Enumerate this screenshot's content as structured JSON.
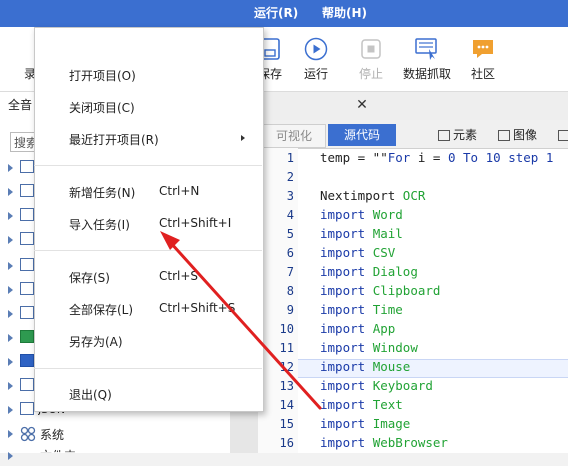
{
  "menubar": {
    "run": "运行(R)",
    "help": "帮助(H)"
  },
  "toolbar": {
    "left_cut": "录",
    "save": "保存",
    "run": "运行",
    "stop": "停止",
    "data_capture": "数据抓取",
    "community": "社区"
  },
  "left_panel": {
    "tab_label": "全音",
    "search_placeholder": "搜索",
    "tree_partial_json": "JSON",
    "tree_system": "系统",
    "tree_partial_bottom": "文件夹"
  },
  "editor": {
    "tab_visual": "可视化",
    "tab_source": "源代码",
    "btn_element": "元素",
    "btn_image": "图像",
    "lines": [
      {
        "n": "1",
        "parts": [
          [
            "",
            "temp = \"\""
          ],
          [
            "kw",
            "For"
          ],
          [
            "",
            " i = "
          ],
          [
            "kw",
            "0"
          ],
          [
            "",
            " "
          ],
          [
            "kw",
            "To"
          ],
          [
            "",
            " "
          ],
          [
            "kw",
            "10"
          ],
          [
            "",
            " "
          ],
          [
            "kw",
            "step"
          ],
          [
            "",
            " "
          ],
          [
            "kw",
            "1"
          ]
        ]
      },
      {
        "n": "2",
        "parts": []
      },
      {
        "n": "3",
        "parts": [
          [
            "",
            "Nextimport "
          ],
          [
            "mod",
            "OCR"
          ]
        ]
      },
      {
        "n": "4",
        "parts": [
          [
            "kw",
            "import"
          ],
          [
            "",
            " "
          ],
          [
            "mod",
            "Word"
          ]
        ]
      },
      {
        "n": "5",
        "parts": [
          [
            "kw",
            "import"
          ],
          [
            "",
            " "
          ],
          [
            "mod",
            "Mail"
          ]
        ]
      },
      {
        "n": "6",
        "parts": [
          [
            "kw",
            "import"
          ],
          [
            "",
            " "
          ],
          [
            "mod",
            "CSV"
          ]
        ]
      },
      {
        "n": "7",
        "parts": [
          [
            "kw",
            "import"
          ],
          [
            "",
            " "
          ],
          [
            "mod",
            "Dialog"
          ]
        ]
      },
      {
        "n": "8",
        "parts": [
          [
            "kw",
            "import"
          ],
          [
            "",
            " "
          ],
          [
            "mod",
            "Clipboard"
          ]
        ]
      },
      {
        "n": "9",
        "parts": [
          [
            "kw",
            "import"
          ],
          [
            "",
            " "
          ],
          [
            "mod",
            "Time"
          ]
        ]
      },
      {
        "n": "10",
        "parts": [
          [
            "kw",
            "import"
          ],
          [
            "",
            " "
          ],
          [
            "mod",
            "App"
          ]
        ]
      },
      {
        "n": "11",
        "parts": [
          [
            "kw",
            "import"
          ],
          [
            "",
            " "
          ],
          [
            "mod",
            "Window"
          ]
        ]
      },
      {
        "n": "12",
        "parts": [
          [
            "kw",
            "import"
          ],
          [
            "",
            " "
          ],
          [
            "mod",
            "Mouse"
          ]
        ]
      },
      {
        "n": "13",
        "parts": [
          [
            "kw",
            "import"
          ],
          [
            "",
            " "
          ],
          [
            "mod",
            "Keyboard"
          ]
        ]
      },
      {
        "n": "14",
        "parts": [
          [
            "kw",
            "import"
          ],
          [
            "",
            " "
          ],
          [
            "mod",
            "Text"
          ]
        ]
      },
      {
        "n": "15",
        "parts": [
          [
            "kw",
            "import"
          ],
          [
            "",
            " "
          ],
          [
            "mod",
            "Image"
          ]
        ]
      },
      {
        "n": "16",
        "parts": [
          [
            "kw",
            "import"
          ],
          [
            "",
            " "
          ],
          [
            "mod",
            "WebBrowser"
          ]
        ]
      }
    ]
  },
  "file_menu": {
    "open_project": "打开项目(O)",
    "close_project": "关闭项目(C)",
    "recent_projects": "最近打开项目(R)",
    "new_task": "新增任务(N)",
    "new_task_shortcut": "Ctrl+N",
    "import_task": "导入任务(I)",
    "import_task_shortcut": "Ctrl+Shift+I",
    "save": "保存(S)",
    "save_shortcut": "Ctrl+S",
    "save_all": "全部保存(L)",
    "save_all_shortcut": "Ctrl+Shift+S",
    "save_as": "另存为(A)",
    "exit": "退出(Q)"
  },
  "colors": {
    "accent": "#3b6fd0",
    "annotation_arrow": "#e02020",
    "keyword": "#1a3aa8",
    "module": "#22a335"
  }
}
